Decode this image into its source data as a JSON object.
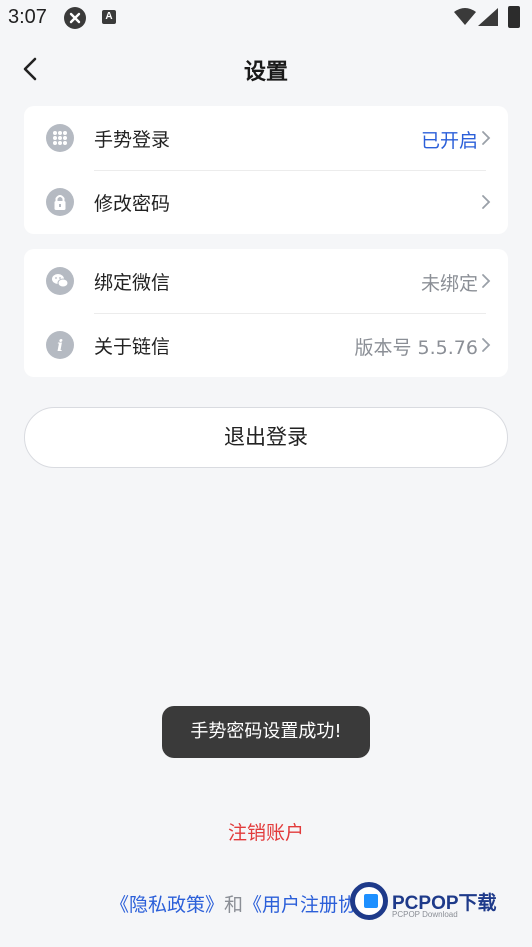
{
  "status_bar": {
    "time": "3:07",
    "icons": [
      "x-circle-icon",
      "a-badge-icon",
      "wifi-icon",
      "signal-icon",
      "battery-icon"
    ]
  },
  "header": {
    "title": "设置",
    "back_icon": "chevron-left-icon"
  },
  "group1": [
    {
      "icon": "grid-dots-icon",
      "label": "手势登录",
      "value": "已开启",
      "value_color": "#2b5fd9"
    },
    {
      "icon": "lock-icon",
      "label": "修改密码",
      "value": ""
    }
  ],
  "group2": [
    {
      "icon": "wechat-icon",
      "label": "绑定微信",
      "value": "未绑定"
    },
    {
      "icon": "info-icon",
      "label": "关于链信",
      "value": "版本号 5.5.76"
    }
  ],
  "logout_label": "退出登录",
  "toast": "手势密码设置成功!",
  "cancel_account": "注销账户",
  "footer": {
    "privacy": "《隐私政策》",
    "and": "和",
    "agreement": "《用户注册协议》"
  },
  "watermark": {
    "text": "PCPOP下载",
    "sub": "PCPOP Download"
  },
  "colors": {
    "link": "#2b5fd9",
    "danger": "#e23b3b",
    "background": "#f5f6f8"
  }
}
